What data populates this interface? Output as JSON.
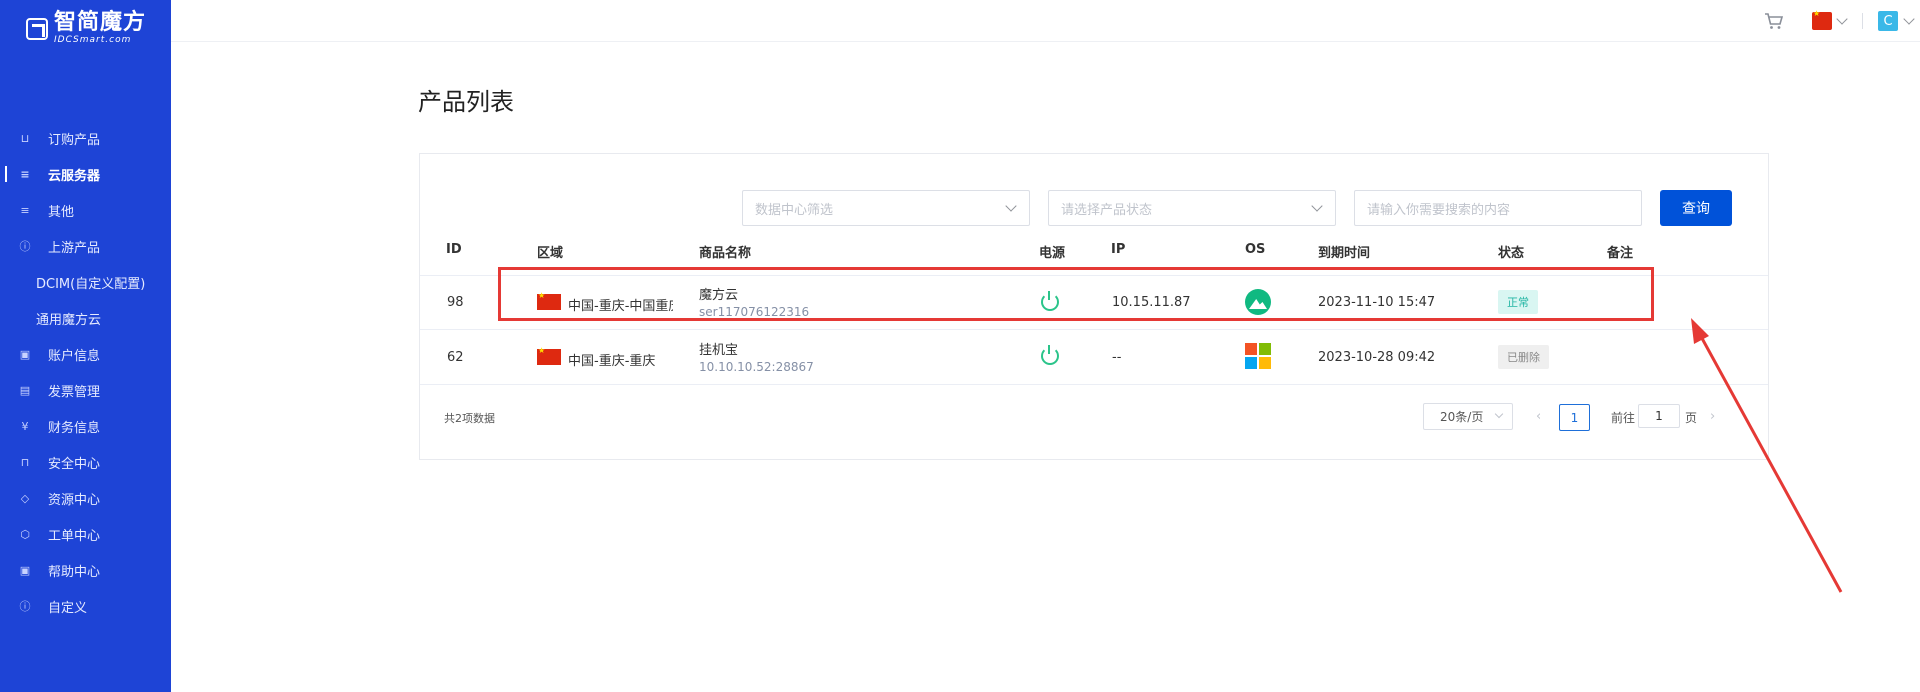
{
  "brand": {
    "name_cn": "智简魔方",
    "name_en": "IDCSmart.com"
  },
  "sidebar": {
    "items": [
      {
        "label": "订购产品",
        "icon": "cart-icon"
      },
      {
        "label": "云服务器",
        "icon": "database-icon",
        "active": true
      },
      {
        "label": "其他",
        "icon": "database-icon"
      },
      {
        "label": "上游产品",
        "icon": "info-circle-icon"
      },
      {
        "label": "DCIM(自定义配置)",
        "icon": ""
      },
      {
        "label": "通用魔方云",
        "icon": ""
      },
      {
        "label": "账户信息",
        "icon": "user-card-icon"
      },
      {
        "label": "发票管理",
        "icon": "invoice-icon"
      },
      {
        "label": "财务信息",
        "icon": "money-icon"
      },
      {
        "label": "安全中心",
        "icon": "lock-icon"
      },
      {
        "label": "资源中心",
        "icon": "tag-icon"
      },
      {
        "label": "工单中心",
        "icon": "box-icon"
      },
      {
        "label": "帮助中心",
        "icon": "help-icon"
      },
      {
        "label": "自定义",
        "icon": "info-circle-icon"
      }
    ]
  },
  "header": {
    "user_initial": "C"
  },
  "page": {
    "title": "产品列表"
  },
  "filters": {
    "datacenter_placeholder": "数据中心筛选",
    "status_placeholder": "请选择产品状态",
    "search_placeholder": "请输入你需要搜索的内容",
    "query_label": "查询"
  },
  "table": {
    "headers": [
      "ID",
      "区域",
      "商品名称",
      "电源",
      "IP",
      "OS",
      "到期时间",
      "状态",
      "备注"
    ],
    "rows": [
      {
        "id": "98",
        "region": "中国-重庆-中国重庆",
        "product": "魔方云",
        "product_sub": "ser117076122316",
        "power": "on",
        "ip": "10.15.11.87",
        "os": "rocky-linux-icon",
        "expire": "2023-11-10 15:47",
        "status": "正常",
        "note": ""
      },
      {
        "id": "62",
        "region": "中国-重庆-重庆",
        "product": "挂机宝",
        "product_sub": "10.10.10.52:28867",
        "power": "on",
        "ip": "--",
        "os": "windows-icon",
        "expire": "2023-10-28 09:42",
        "status": "已删除",
        "note": ""
      }
    ]
  },
  "pagination": {
    "total": "共2项数据",
    "page_size": "20条/页",
    "current_page": "1",
    "goto_prefix": "前往",
    "goto_value": "1",
    "goto_suffix": "页"
  },
  "colors": {
    "sidebar": "#1e44d6",
    "primary": "#0052d9",
    "annotation": "#e53935"
  }
}
